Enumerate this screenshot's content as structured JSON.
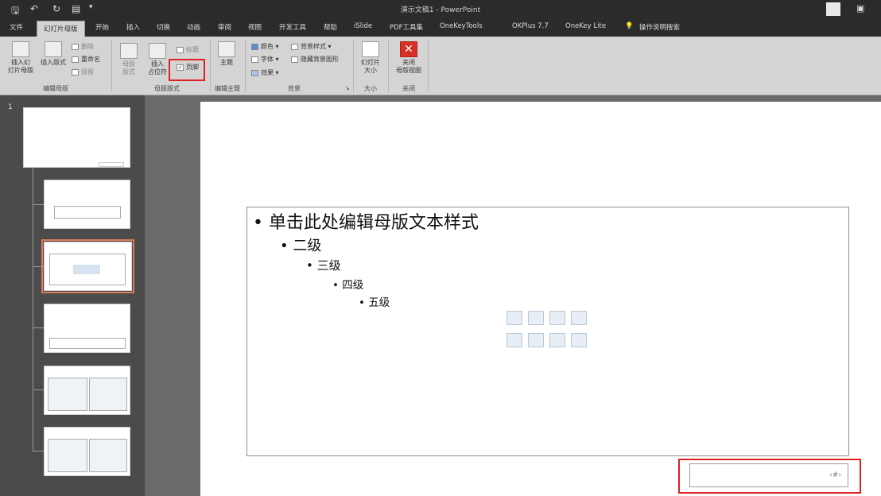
{
  "titlebar": {
    "title": "演示文稿1 - PowerPoint",
    "save_icon": "save-icon",
    "undo_icon": "undo-icon",
    "redo_icon": "redo-icon"
  },
  "tabs": [
    {
      "label": "文件"
    },
    {
      "label": "幻灯片母版"
    },
    {
      "label": "开始"
    },
    {
      "label": "插入"
    },
    {
      "label": "切换"
    },
    {
      "label": "动画"
    },
    {
      "label": "审阅"
    },
    {
      "label": "视图"
    },
    {
      "label": "开发工具"
    },
    {
      "label": "帮助"
    },
    {
      "label": "iSlide"
    },
    {
      "label": "PDF工具集"
    },
    {
      "label": "OneKeyTools"
    },
    {
      "label": "OKPlus 7.7"
    },
    {
      "label": "OneKey Lite"
    },
    {
      "label": "操作说明搜索"
    }
  ],
  "ribbon": {
    "edit_master": {
      "insert_slide_master": "插入幻\n灯片母版",
      "insert_layout": "插入版式",
      "delete": "删除",
      "rename": "重命名",
      "preserve": "保留",
      "group_label": "编辑母版"
    },
    "master_layout": {
      "master_layout": "母版\n版式",
      "insert_placeholder": "插入\n占位符",
      "title_check": "标题",
      "footer_check": "页脚",
      "group_label": "母版版式"
    },
    "edit_theme": {
      "themes": "主题",
      "group_label": "编辑主题"
    },
    "background": {
      "colors": "颜色",
      "fonts": "字体",
      "effects": "效果",
      "background_styles": "背景样式",
      "hide_background": "隐藏背景图形",
      "group_label": "背景"
    },
    "size": {
      "slide_size": "幻灯片\n大小",
      "group_label": "大小"
    },
    "close": {
      "close_master": "关闭\n母版视图",
      "group_label": "关闭"
    }
  },
  "slides_pane": {
    "slide_number": "1"
  },
  "slide": {
    "level1": "单击此处编辑母版文本样式",
    "level2": "二级",
    "level3": "三级",
    "level4": "四级",
    "level5": "五级",
    "footer_text": "‹#›"
  }
}
